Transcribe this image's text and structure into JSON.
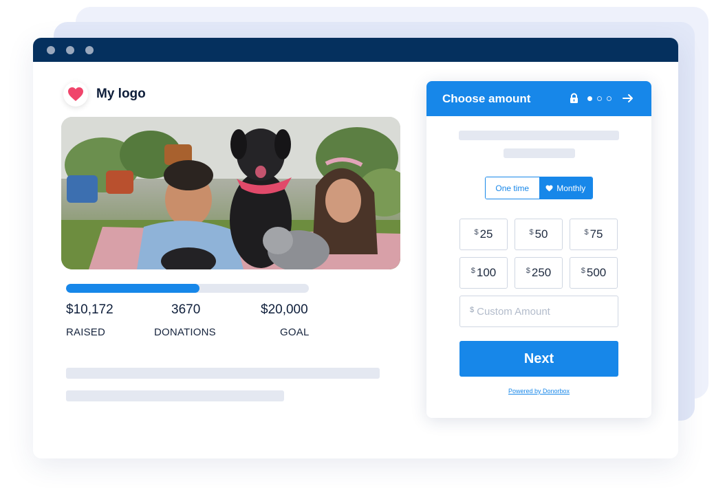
{
  "logo": {
    "text": "My logo",
    "icon": "heart-icon",
    "color": "#f0456b"
  },
  "campaign": {
    "progress": 0.55,
    "raised_value": "$10,172",
    "raised_label": "RAISED",
    "donations_value": "3670",
    "donations_label": "DONATIONS",
    "goal_value": "$20,000",
    "goal_label": "GOAL"
  },
  "form": {
    "title": "Choose amount",
    "step_current": 1,
    "step_total": 3,
    "frequency": {
      "options": [
        "One time",
        "Monthly"
      ],
      "selected": "Monthly"
    },
    "currency_symbol": "$",
    "amounts": [
      "25",
      "50",
      "75",
      "100",
      "250",
      "500"
    ],
    "custom_placeholder": "Custom Amount",
    "next_label": "Next",
    "powered_by": "Powered by Donorbox"
  },
  "colors": {
    "titlebar": "#05305e",
    "accent": "#1787e9",
    "skeleton": "#e4e8f1"
  }
}
